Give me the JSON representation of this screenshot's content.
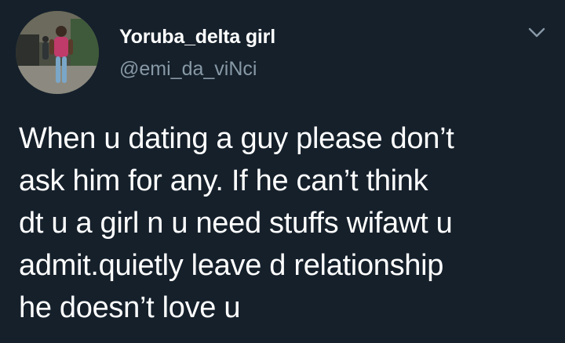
{
  "author": {
    "display_name": "Yoruba_delta girl",
    "handle": "@emi_da_viNci",
    "avatar_icon": "profile-photo"
  },
  "menu": {
    "icon": "chevron-down-icon"
  },
  "tweet": {
    "lines": [
      "When u dating a guy please don’t",
      "ask him for any. If he can’t think",
      "dt u a girl n u need stuffs wifawt u",
      "admit.quietly leave d relationship",
      "he doesn’t love u"
    ]
  },
  "colors": {
    "background": "#15202b",
    "text": "#ffffff",
    "secondary": "#8899a6"
  }
}
